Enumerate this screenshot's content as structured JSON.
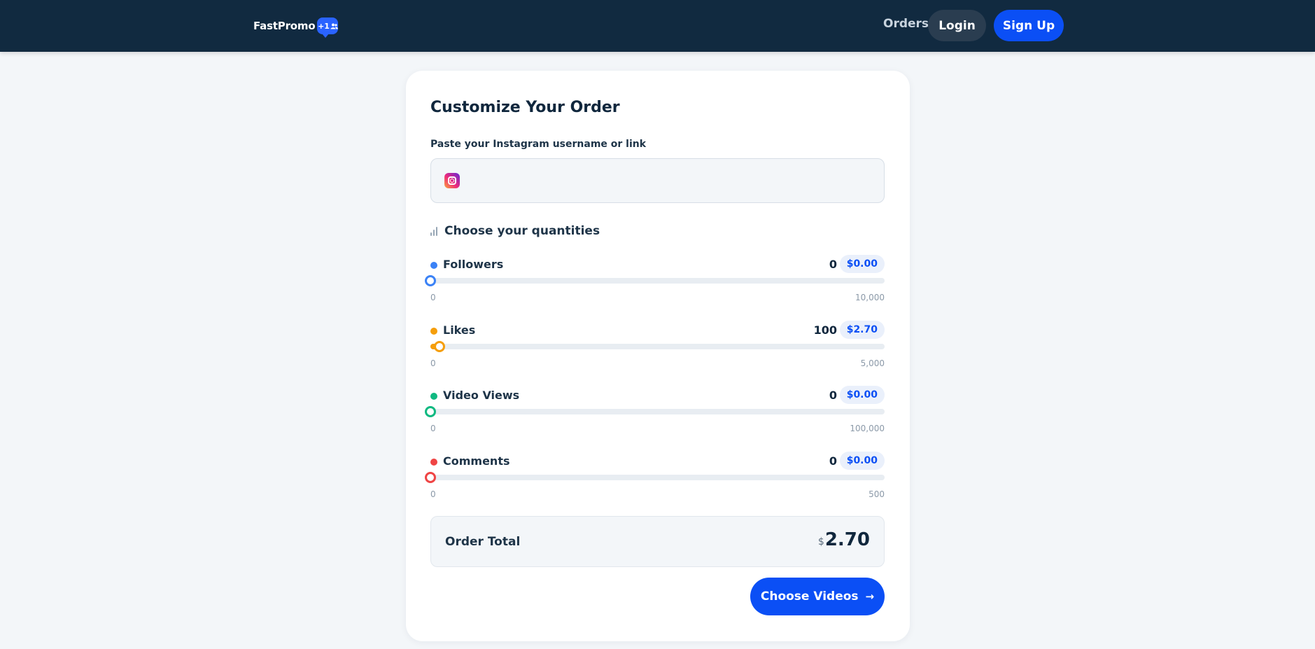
{
  "nav": {
    "brand": "FastPromo",
    "badge": "+1",
    "orders": "Orders",
    "login": "Login",
    "signup": "Sign Up"
  },
  "card": {
    "title": "Customize Your Order",
    "input_label": "Paste your Instagram username or link",
    "input_value": "",
    "quantities_heading": "Choose your quantities",
    "sliders": [
      {
        "label": "Followers",
        "qty": "0",
        "price": "$0.00",
        "min": "0",
        "max": "10,000",
        "value": 0,
        "max_value": 10000,
        "color": "#3b82f6"
      },
      {
        "label": "Likes",
        "qty": "100",
        "price": "$2.70",
        "min": "0",
        "max": "5,000",
        "value": 100,
        "max_value": 5000,
        "color": "#f59e0b"
      },
      {
        "label": "Video Views",
        "qty": "0",
        "price": "$0.00",
        "min": "0",
        "max": "100,000",
        "value": 0,
        "max_value": 100000,
        "color": "#10b981"
      },
      {
        "label": "Comments",
        "qty": "0",
        "price": "$0.00",
        "min": "0",
        "max": "500",
        "value": 0,
        "max_value": 500,
        "color": "#ef4444"
      }
    ],
    "total_label": "Order Total",
    "total_currency": "$",
    "total_amount": "2.70",
    "cta": "Choose Videos",
    "cta_arrow": "→"
  }
}
